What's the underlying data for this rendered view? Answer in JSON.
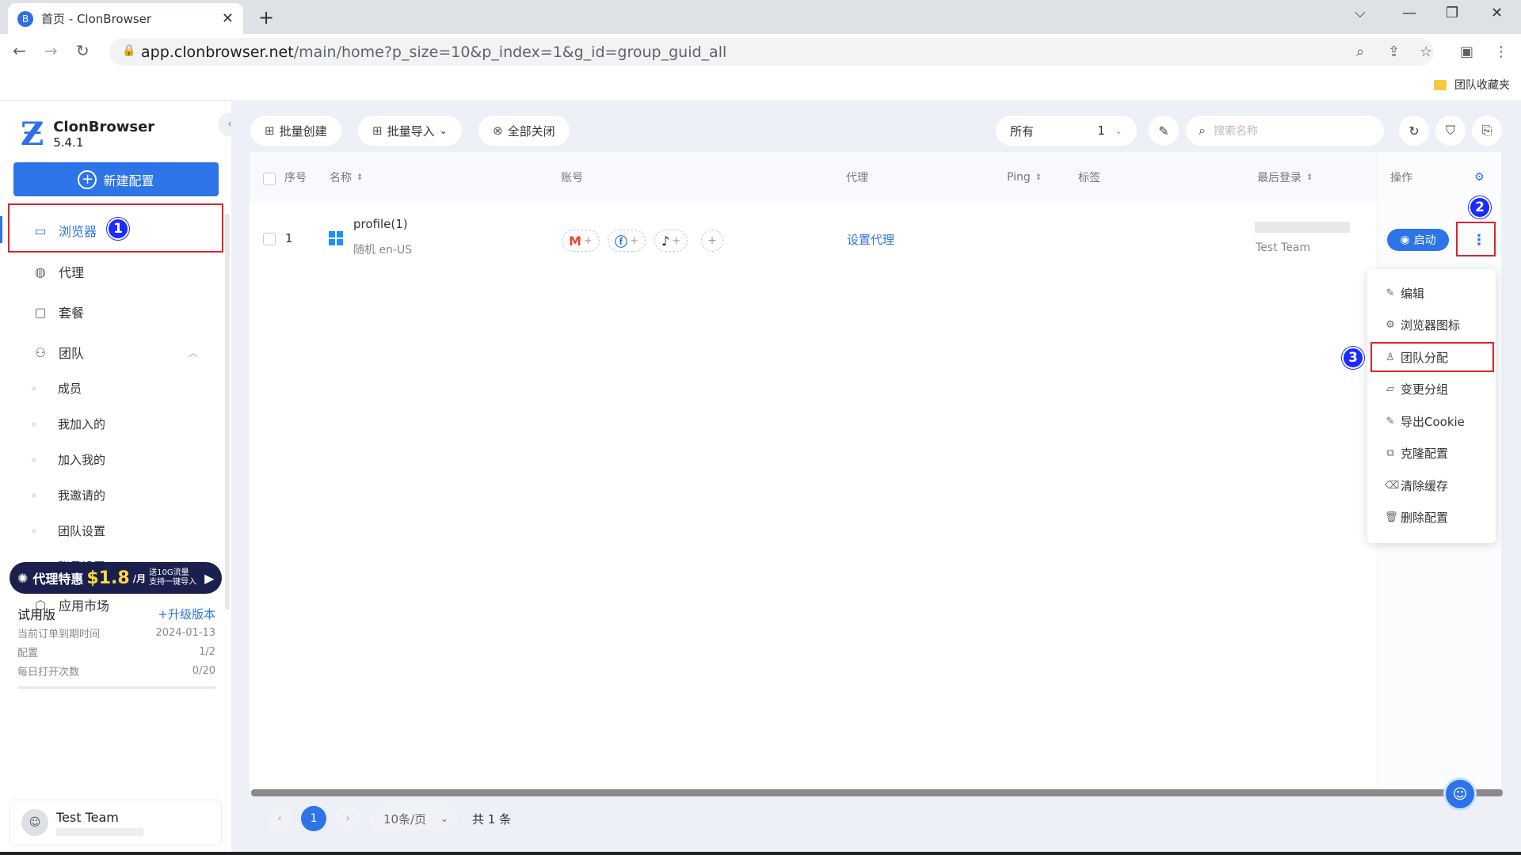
{
  "browser": {
    "tab_title": "首页 - ClonBrowser",
    "url_host": "app.clonbrowser.net",
    "url_path": "/main/home?p_size=10&p_index=1&g_id=group_guid_all",
    "bookmark_folder": "团队收藏夹"
  },
  "sidebar": {
    "app_name": "ClonBrowser",
    "version": "5.4.1",
    "new_config": "新建配置",
    "items": [
      {
        "label": "浏览器",
        "icon": "browser-icon"
      },
      {
        "label": "代理",
        "icon": "globe-icon"
      },
      {
        "label": "套餐",
        "icon": "wallet-icon"
      },
      {
        "label": "团队",
        "icon": "team-icon"
      },
      {
        "label": "应用市场",
        "icon": "cube-icon"
      }
    ],
    "team_sub": [
      "成员",
      "我加入的",
      "加入我的",
      "我邀请的",
      "团队设置",
      "账号设置"
    ],
    "promo": {
      "text": "代理特惠",
      "price": "$1.8",
      "unit": "/月",
      "line1": "送10G流量",
      "line2": "支持一键导入"
    },
    "trial": {
      "title": "试用版",
      "upgrade": "+升级版本",
      "expiry_label": "当前订单到期时间",
      "expiry_value": "2024-01-13",
      "config_label": "配置",
      "config_value": "1/2",
      "open_label": "每日打开次数",
      "open_value": "0/20"
    },
    "user": {
      "name": "Test Team"
    }
  },
  "toolbar": {
    "batch_create": "批量创建",
    "batch_import": "批量导入",
    "close_all": "全部关闭",
    "group_select": "所有",
    "group_count": "1",
    "search_placeholder": "搜索名称"
  },
  "table": {
    "headers": {
      "index": "序号",
      "name": "名称",
      "account": "账号",
      "proxy": "代理",
      "ping": "Ping",
      "tag": "标签",
      "last_login": "最后登录",
      "ops": "操作"
    },
    "rows": [
      {
        "index": "1",
        "name": "profile(1)",
        "locale": "随机 en-US",
        "proxy": "设置代理",
        "last_login_user": "Test Team",
        "start": "启动"
      }
    ]
  },
  "dropdown": [
    "编辑",
    "浏览器图标",
    "团队分配",
    "变更分组",
    "导出Cookie",
    "克隆配置",
    "清除缓存",
    "删除配置"
  ],
  "annotations": [
    "1",
    "2",
    "3"
  ],
  "pagination": {
    "current": "1",
    "page_size": "10条/页",
    "total": "共 1 条"
  },
  "colors": {
    "accent": "#2d74e8",
    "highlight": "#d9262c",
    "badge": "#1a2cff"
  }
}
